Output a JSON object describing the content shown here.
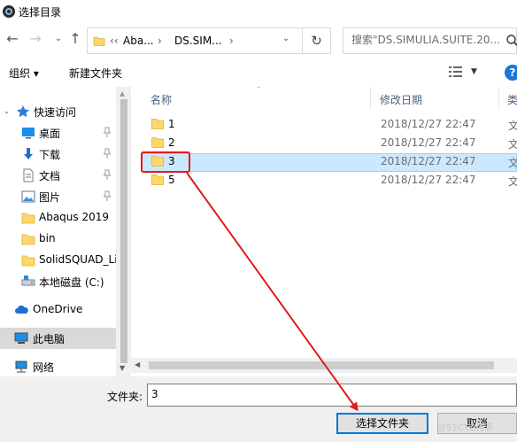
{
  "window": {
    "title": "选择目录"
  },
  "address": {
    "breadcrumb": [
      "‹‹",
      "Aba...",
      "›",
      "DS.SIM...",
      "›"
    ],
    "search_placeholder": "搜索\"DS.SIMULIA.SUITE.20..."
  },
  "toolbar": {
    "organize": "组织 ▾",
    "new_folder": "新建文件夹"
  },
  "nav": {
    "items": [
      {
        "label": "快速访问",
        "icon": "star-icon"
      },
      {
        "label": "桌面",
        "icon": "desktop-icon",
        "pinned": true
      },
      {
        "label": "下载",
        "icon": "download-icon",
        "pinned": true
      },
      {
        "label": "文档",
        "icon": "document-icon",
        "pinned": true
      },
      {
        "label": "图片",
        "icon": "picture-icon",
        "pinned": true
      },
      {
        "label": "Abaqus 2019",
        "icon": "folder-icon"
      },
      {
        "label": "bin",
        "icon": "folder-icon"
      },
      {
        "label": "SolidSQUAD_Li",
        "icon": "folder-icon"
      },
      {
        "label": "本地磁盘 (C:)",
        "icon": "drive-icon"
      },
      {
        "label": "OneDrive",
        "icon": "cloud-icon"
      },
      {
        "label": "此电脑",
        "icon": "computer-icon",
        "selected": true
      },
      {
        "label": "网络",
        "icon": "network-icon"
      }
    ]
  },
  "files": {
    "columns": {
      "name": "名称",
      "modified": "修改日期",
      "type": "类"
    },
    "rows": [
      {
        "name": "1",
        "modified": "2018/12/27 22:47",
        "type": "文"
      },
      {
        "name": "2",
        "modified": "2018/12/27 22:47",
        "type": "文"
      },
      {
        "name": "3",
        "modified": "2018/12/27 22:47",
        "type": "文",
        "selected": true
      },
      {
        "name": "5",
        "modified": "2018/12/27 22:47",
        "type": "文"
      }
    ]
  },
  "footer": {
    "folder_label": "文件夹:",
    "folder_value": "3",
    "select_button": "选择文件夹",
    "cancel_button": "取消"
  },
  "watermark": "@51CTO博客",
  "colors": {
    "accent": "#0078d7",
    "selection_bg": "#cce8ff",
    "annotation_red": "#e21b1b",
    "folder_yellow": "#ffd766"
  }
}
